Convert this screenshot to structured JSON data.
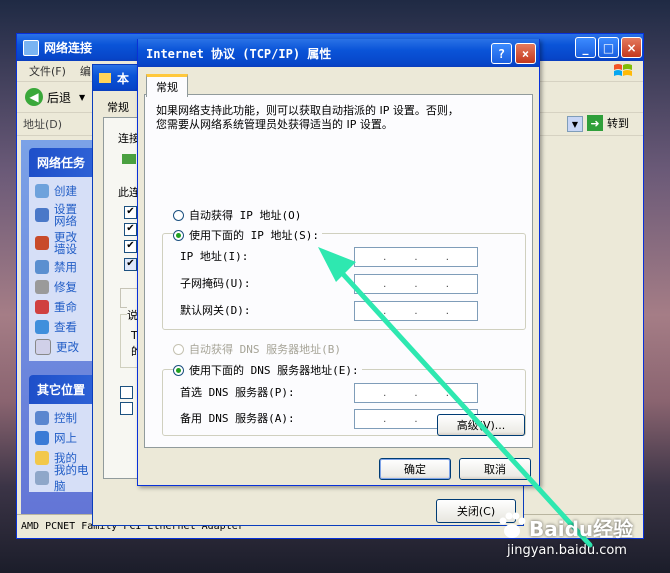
{
  "net_window": {
    "title": "网络连接",
    "menu": [
      "文件(F)",
      "编"
    ],
    "back_label": "后退",
    "address_label": "地址(D)",
    "go_label": "转到",
    "tasks_header": "网络任务",
    "tasks": [
      "创建",
      "设置\n网络",
      "更改\n墙设",
      "禁用",
      "修复",
      "重命",
      "查看",
      "更改"
    ],
    "other_header": "其它位置",
    "other_places": [
      "控制",
      "网上",
      "我的",
      "我的电脑"
    ],
    "status": "AMD PCNET Family PCI Ethernet Adapter"
  },
  "mid_window": {
    "title": "本",
    "tab": "常规",
    "connect_label": "连接",
    "this_label": "此连",
    "desc_label": "说",
    "desc_lines": [
      "T",
      "的"
    ],
    "close_button": "关闭(C)"
  },
  "tcp_dialog": {
    "title": "Internet 协议 (TCP/IP) 属性",
    "help_btn": "?",
    "close_btn": "×",
    "tab": "常规",
    "intro_line1": "如果网络支持此功能，则可以获取自动指派的 IP 设置。否则，",
    "intro_line2": "您需要从网络系统管理员处获得适当的 IP 设置。",
    "radio_auto_ip": "自动获得 IP 地址(O)",
    "radio_manual_ip": "使用下面的 IP 地址(S):",
    "ip_label": "IP 地址(I):",
    "mask_label": "子网掩码(U):",
    "gateway_label": "默认网关(D):",
    "radio_auto_dns": "自动获得 DNS 服务器地址(B)",
    "radio_manual_dns": "使用下面的 DNS 服务器地址(E):",
    "dns_pref_label": "首选 DNS 服务器(P):",
    "dns_alt_label": "备用 DNS 服务器(A):",
    "ip_dots": ".",
    "advanced_button": "高级(V)...",
    "ok_button": "确定",
    "cancel_button": "取消"
  },
  "watermark": {
    "brand": "Baidu经验",
    "url": "jingyan.baidu.com"
  },
  "colors": {
    "arrow": "#2ee8b0",
    "xp_title": "#0a54d8",
    "selected_radio": "#21a121"
  }
}
